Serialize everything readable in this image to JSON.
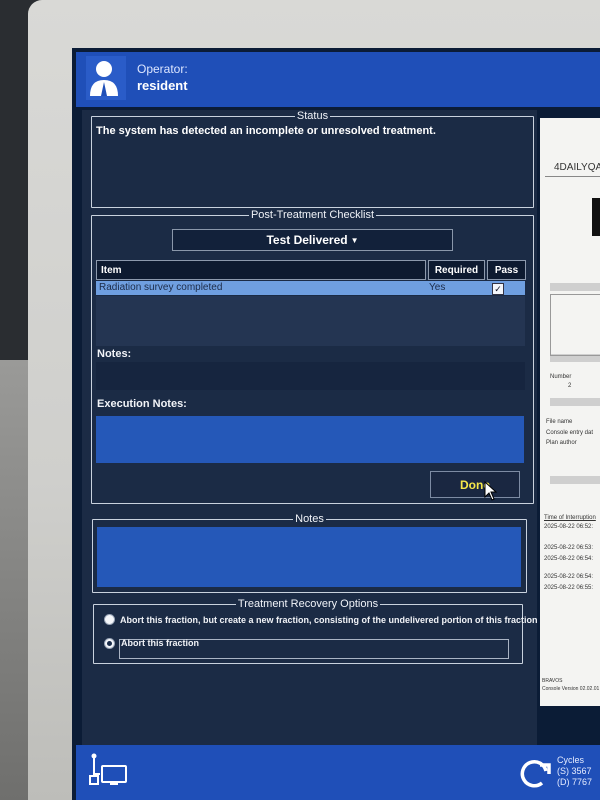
{
  "operator": {
    "label": "Operator:",
    "name": "resident"
  },
  "status": {
    "legend": "Status",
    "message": "The system has detected an incomplete or unresolved treatment."
  },
  "checklist": {
    "legend": "Post-Treatment Checklist",
    "dropdown_value": "Test Delivered",
    "columns": {
      "item": "Item",
      "required": "Required",
      "pass": "Pass"
    },
    "rows": [
      {
        "item": "Radiation survey completed",
        "required": "Yes",
        "pass_checked": "✓"
      }
    ],
    "notes_label": "Notes:",
    "execution_notes_label": "Execution Notes:",
    "done_label": "Done"
  },
  "notes": {
    "legend": "Notes"
  },
  "recovery": {
    "legend": "Treatment Recovery Options",
    "options": [
      {
        "label": "Abort this fraction, but create a new fraction, consisting of the undelivered portion of this fraction",
        "selected": false
      },
      {
        "label": "Abort this fraction",
        "selected": true
      }
    ]
  },
  "footer": {
    "cycles_label": "Cycles",
    "cycles_s": "(S) 3567",
    "cycles_d": "(D) 7767"
  },
  "document": {
    "title": "4DAILYQA",
    "number_label": "Number",
    "number_value": "2",
    "file_name": "File name",
    "console_entry": "Console entry dat",
    "plan_author": "Plan author",
    "interruption_label": "Time of Interruption",
    "times": [
      "2025-08-22 06:52:",
      "2025-08-22 06:53:",
      "2025-08-22 06:54:",
      "2025-08-22 06:54:",
      "2025-08-22 06:55:"
    ],
    "brand": "BRAVOS",
    "console_version": "Console Version 02.02.01"
  },
  "colors": {
    "header_blue": "#1f4fb8",
    "panel": "#1b2b45",
    "selected_row": "#6f9fe0",
    "done_text": "#f6e84a"
  }
}
